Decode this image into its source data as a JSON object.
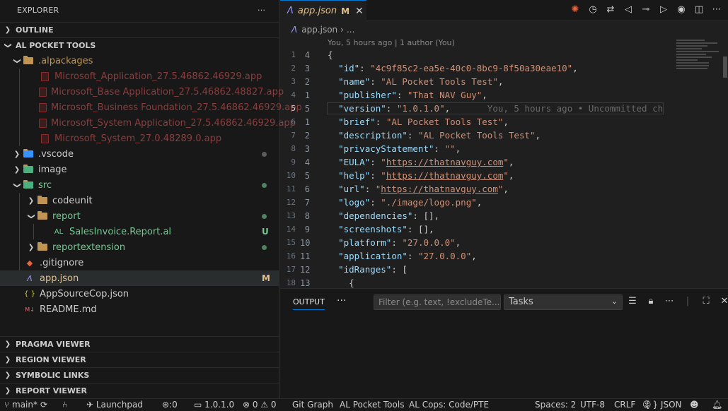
{
  "sidebar": {
    "title": "EXPLORER",
    "more": "···",
    "outline": "OUTLINE",
    "project": "AL POCKET TOOLS",
    "items": [
      {
        "name": ".alpackages",
        "color": "#c09553"
      },
      {
        "name": "Microsoft_Application_27.5.46862.46929.app"
      },
      {
        "name": "Microsoft_Base Application_27.5.46862.48827.app"
      },
      {
        "name": "Microsoft_Business Foundation_27.5.46862.46929.app"
      },
      {
        "name": "Microsoft_System Application_27.5.46862.46929.app"
      },
      {
        "name": "Microsoft_System_27.0.48289.0.app"
      },
      {
        "name": ".vscode"
      },
      {
        "name": "image"
      },
      {
        "name": "src"
      },
      {
        "name": "codeunit"
      },
      {
        "name": "report"
      },
      {
        "name": "SalesInvoice.Report.al",
        "badge": "U",
        "icon": "AL"
      },
      {
        "name": "reportextension"
      },
      {
        "name": ".gitignore"
      },
      {
        "name": "app.json",
        "badge": "M"
      },
      {
        "name": "AppSourceCop.json",
        "icon": "{ }"
      },
      {
        "name": "README.md"
      }
    ],
    "bottom_sections": [
      "PRAGMA VIEWER",
      "REGION VIEWER",
      "SYMBOLIC LINKS",
      "REPORT VIEWER"
    ]
  },
  "tab": {
    "label": "app.json",
    "badge": "M"
  },
  "breadcrumb": {
    "file": "app.json",
    "rest": "..."
  },
  "blame_header": "You, 5 hours ago | 1 author (You)",
  "editor": {
    "lines": [
      {
        "n": "1",
        "r": "4",
        "html": [
          [
            "p",
            "{"
          ]
        ]
      },
      {
        "n": "2",
        "r": "3",
        "html": [
          [
            "p",
            "  "
          ],
          [
            "k",
            "\"id\""
          ],
          [
            "p",
            ": "
          ],
          [
            "s",
            "\"4c9f85c2-ea5e-40c0-8bc9-8f50a30eae10\""
          ],
          [
            "p",
            ","
          ]
        ]
      },
      {
        "n": "3",
        "r": "2",
        "html": [
          [
            "p",
            "  "
          ],
          [
            "k",
            "\"name\""
          ],
          [
            "p",
            ": "
          ],
          [
            "s",
            "\"AL Pocket Tools Test\""
          ],
          [
            "p",
            ","
          ]
        ]
      },
      {
        "n": "4",
        "r": "1",
        "html": [
          [
            "p",
            "  "
          ],
          [
            "k",
            "\"publisher\""
          ],
          [
            "p",
            ": "
          ],
          [
            "s",
            "\"That NAV Guy\""
          ],
          [
            "p",
            ","
          ]
        ]
      },
      {
        "n": "5",
        "r": "5",
        "cur": true,
        "html": [
          [
            "p",
            "  "
          ],
          [
            "k",
            "\"version\""
          ],
          [
            "p",
            ": "
          ],
          [
            "s",
            "\"1.0.1.0\""
          ],
          [
            "p",
            ","
          ],
          [
            "ghost",
            "       You, 5 hours ago • Uncommitted ch"
          ]
        ]
      },
      {
        "n": "6",
        "r": "1",
        "html": [
          [
            "p",
            "  "
          ],
          [
            "k",
            "\"brief\""
          ],
          [
            "p",
            ": "
          ],
          [
            "s",
            "\"AL Pocket Tools Test\""
          ],
          [
            "p",
            ","
          ]
        ]
      },
      {
        "n": "7",
        "r": "2",
        "html": [
          [
            "p",
            "  "
          ],
          [
            "k",
            "\"description\""
          ],
          [
            "p",
            ": "
          ],
          [
            "s",
            "\"AL Pocket Tools Test\""
          ],
          [
            "p",
            ","
          ]
        ]
      },
      {
        "n": "8",
        "r": "3",
        "html": [
          [
            "p",
            "  "
          ],
          [
            "k",
            "\"privacyStatement\""
          ],
          [
            "p",
            ": "
          ],
          [
            "s",
            "\"\""
          ],
          [
            "p",
            ","
          ]
        ]
      },
      {
        "n": "9",
        "r": "4",
        "html": [
          [
            "p",
            "  "
          ],
          [
            "k",
            "\"EULA\""
          ],
          [
            "p",
            ": "
          ],
          [
            "s",
            "\""
          ],
          [
            "u",
            "https://thatnavguy.com"
          ],
          [
            "s",
            "\""
          ],
          [
            "p",
            ","
          ]
        ]
      },
      {
        "n": "10",
        "r": "5",
        "html": [
          [
            "p",
            "  "
          ],
          [
            "k",
            "\"help\""
          ],
          [
            "p",
            ": "
          ],
          [
            "s",
            "\""
          ],
          [
            "u",
            "https://thatnavguy.com"
          ],
          [
            "s",
            "\""
          ],
          [
            "p",
            ","
          ]
        ]
      },
      {
        "n": "11",
        "r": "6",
        "html": [
          [
            "p",
            "  "
          ],
          [
            "k",
            "\"url\""
          ],
          [
            "p",
            ": "
          ],
          [
            "s",
            "\""
          ],
          [
            "u",
            "https://thatnavguy.com"
          ],
          [
            "s",
            "\""
          ],
          [
            "p",
            ","
          ]
        ]
      },
      {
        "n": "12",
        "r": "7",
        "html": [
          [
            "p",
            "  "
          ],
          [
            "k",
            "\"logo\""
          ],
          [
            "p",
            ": "
          ],
          [
            "s",
            "\"./image/logo.png\""
          ],
          [
            "p",
            ","
          ]
        ]
      },
      {
        "n": "13",
        "r": "8",
        "html": [
          [
            "p",
            "  "
          ],
          [
            "k",
            "\"dependencies\""
          ],
          [
            "p",
            ": [],"
          ]
        ]
      },
      {
        "n": "14",
        "r": "9",
        "html": [
          [
            "p",
            "  "
          ],
          [
            "k",
            "\"screenshots\""
          ],
          [
            "p",
            ": [],"
          ]
        ]
      },
      {
        "n": "15",
        "r": "10",
        "html": [
          [
            "p",
            "  "
          ],
          [
            "k",
            "\"platform\""
          ],
          [
            "p",
            ": "
          ],
          [
            "s",
            "\"27.0.0.0\""
          ],
          [
            "p",
            ","
          ]
        ]
      },
      {
        "n": "16",
        "r": "11",
        "html": [
          [
            "p",
            "  "
          ],
          [
            "k",
            "\"application\""
          ],
          [
            "p",
            ": "
          ],
          [
            "s",
            "\"27.0.0.0\""
          ],
          [
            "p",
            ","
          ]
        ]
      },
      {
        "n": "17",
        "r": "12",
        "html": [
          [
            "p",
            "  "
          ],
          [
            "k",
            "\"idRanges\""
          ],
          [
            "p",
            ": ["
          ]
        ]
      },
      {
        "n": "18",
        "r": "13",
        "html": [
          [
            "p",
            "    {"
          ]
        ]
      }
    ]
  },
  "panel": {
    "tab": "OUTPUT",
    "more": "···",
    "filter_placeholder": "Filter (e.g. text, !excludeTe...",
    "select_value": "Tasks"
  },
  "status": {
    "branch": "main*",
    "launchpad": "Launchpad",
    "ports": "0",
    "version": "1.0.1.0",
    "errors": "0",
    "warnings": "0",
    "git_graph": "Git Graph",
    "al_tools": "AL Pocket Tools",
    "al_cops": "AL Cops: Code/PTE",
    "spaces": "Spaces: 2",
    "encoding": "UTF-8",
    "eol": "CRLF",
    "language": "JSON",
    "lang_icon": "{ }"
  }
}
